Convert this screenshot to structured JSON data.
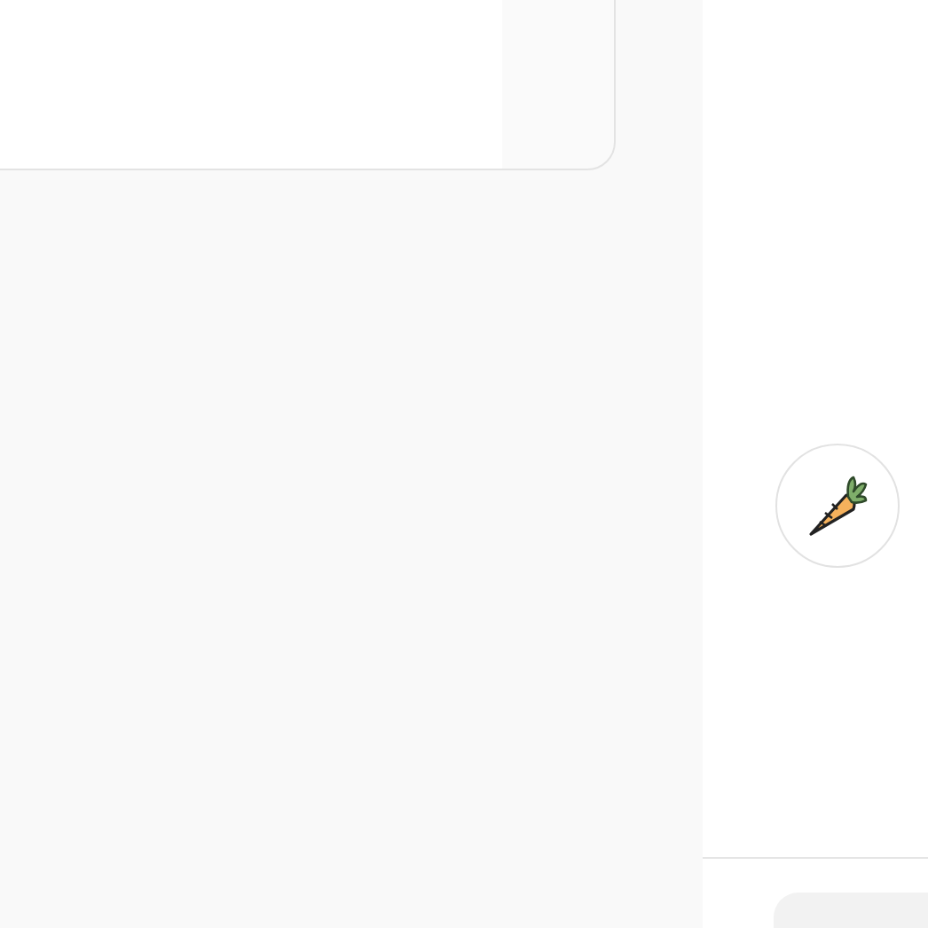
{
  "assistant_avatar": {
    "kind": "carrot"
  }
}
